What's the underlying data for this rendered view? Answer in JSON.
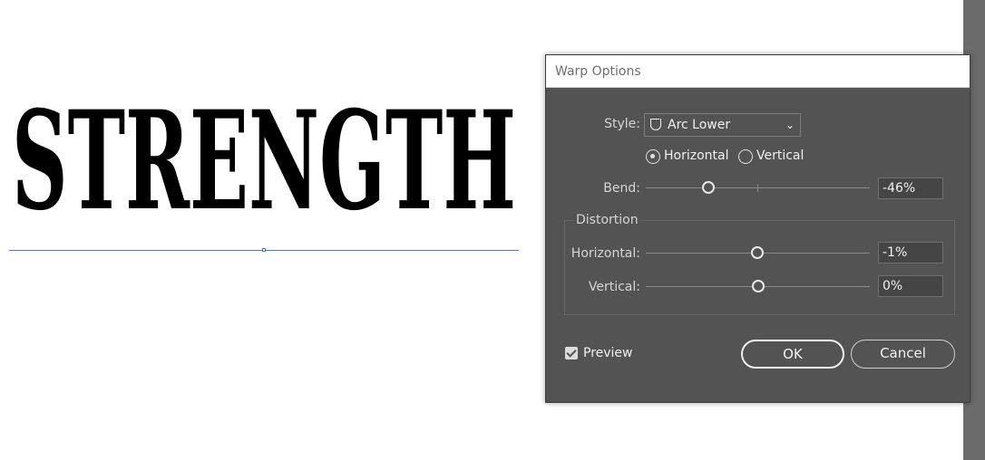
{
  "artwork": {
    "text": "STRENGTH"
  },
  "dialog": {
    "title": "Warp Options",
    "style": {
      "label": "Style:",
      "value": "Arc Lower",
      "icon": "arc-lower-icon"
    },
    "orientation": {
      "horizontal": "Horizontal",
      "vertical": "Vertical",
      "selected": "Horizontal"
    },
    "bend": {
      "label": "Bend:",
      "value": "-46%",
      "level": -46
    },
    "distortion": {
      "title": "Distortion",
      "horizontal": {
        "label": "Horizontal:",
        "value": "-1%",
        "level": -1
      },
      "vertical": {
        "label": "Vertical:",
        "value": "0%",
        "level": 0
      }
    },
    "preview": {
      "label": "Preview",
      "checked": true
    },
    "ok_label": "OK",
    "cancel_label": "Cancel"
  }
}
